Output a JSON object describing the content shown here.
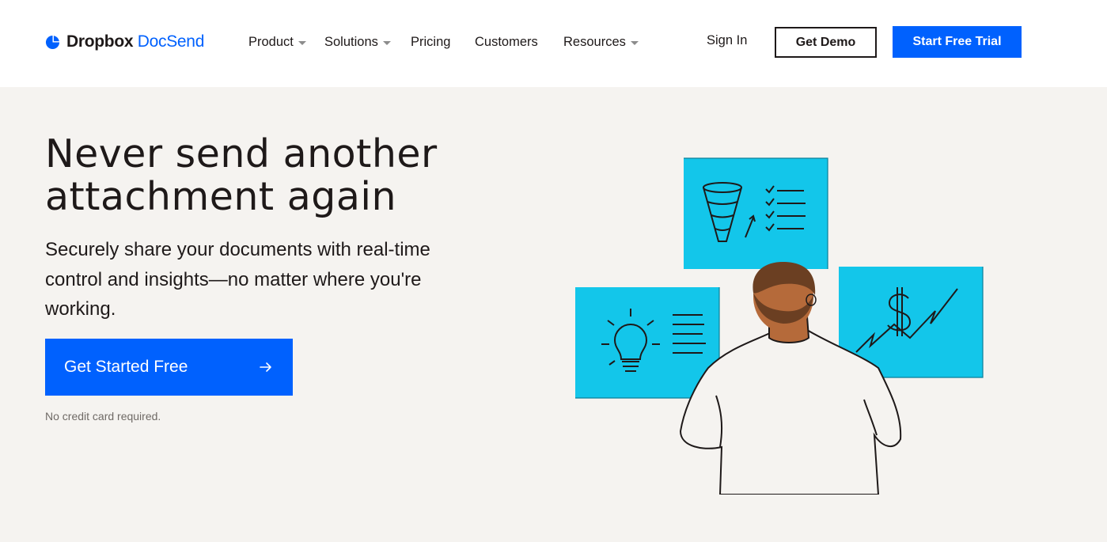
{
  "brand": {
    "name_part1": "Dropbox",
    "name_part2": "DocSend",
    "accent_color": "#0061fe",
    "logo_icon": "docsend-logo-icon"
  },
  "nav": {
    "items": [
      {
        "label": "Product",
        "has_dropdown": true
      },
      {
        "label": "Solutions",
        "has_dropdown": true
      },
      {
        "label": "Pricing",
        "has_dropdown": false
      },
      {
        "label": "Customers",
        "has_dropdown": false
      },
      {
        "label": "Resources",
        "has_dropdown": true
      }
    ],
    "sign_in": "Sign In",
    "get_demo": "Get Demo",
    "start_trial": "Start Free Trial"
  },
  "hero": {
    "title_line1": "Never send another",
    "title_line2": "attachment again",
    "subtitle": "Securely share your documents with real-time control and insights—no matter where you're working.",
    "cta_label": "Get Started Free",
    "cta_icon": "arrow-right-icon",
    "note": "No credit card required."
  },
  "illustration": {
    "panel_color": "#13c6ea",
    "skin_color": "#b56a3a",
    "hair_color": "#6b3f22",
    "icons": [
      "funnel-icon",
      "lightbulb-icon",
      "dollar-chart-icon",
      "checklist-icon"
    ]
  }
}
